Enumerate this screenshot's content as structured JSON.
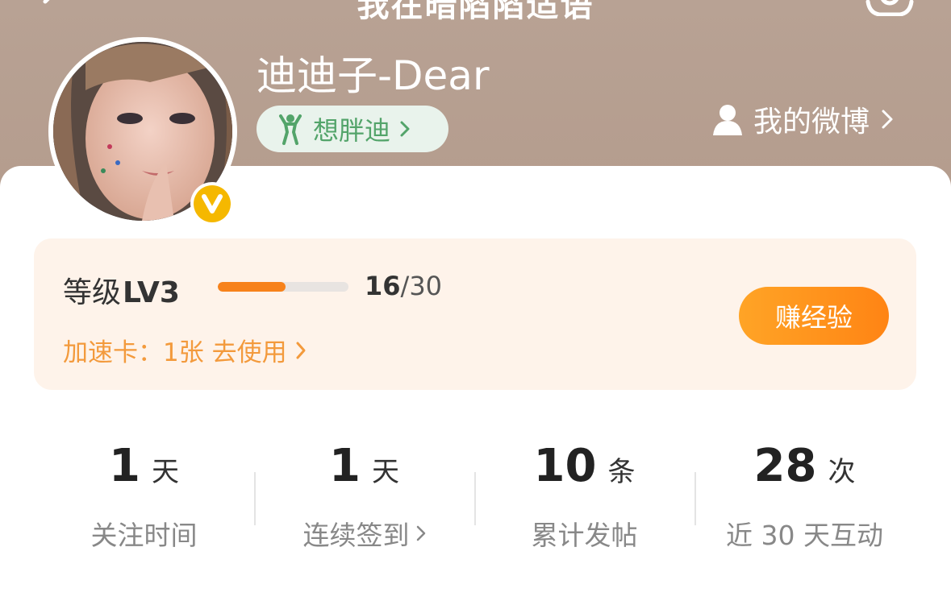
{
  "header": {
    "title": "我在暗陷陷适语",
    "nickname": "迪迪子-Dear",
    "fan_tag": "想胖迪",
    "my_weibo": "我的微博"
  },
  "level": {
    "label": "等级",
    "level": "LV3",
    "current": "16",
    "total": "/30",
    "progress": 0.52,
    "boost": "加速卡：1张 去使用",
    "earn_button": "赚经验"
  },
  "stats": [
    {
      "value": "1",
      "unit": "天",
      "label": "关注时间"
    },
    {
      "value": "1",
      "unit": "天",
      "label": "连续签到"
    },
    {
      "value": "10",
      "unit": "条",
      "label": "累计发帖"
    },
    {
      "value": "28",
      "unit": "次",
      "label": "近 30 天互动"
    }
  ],
  "colors": {
    "accent": "#f7821b",
    "fan_tag_green": "#53a46a",
    "header_bg": "#b8a294",
    "verified": "#f5b800"
  },
  "icons": [
    "back-icon",
    "settings-icon",
    "verified-icon",
    "fan-icon",
    "user-icon",
    "chevron-right-icon"
  ]
}
